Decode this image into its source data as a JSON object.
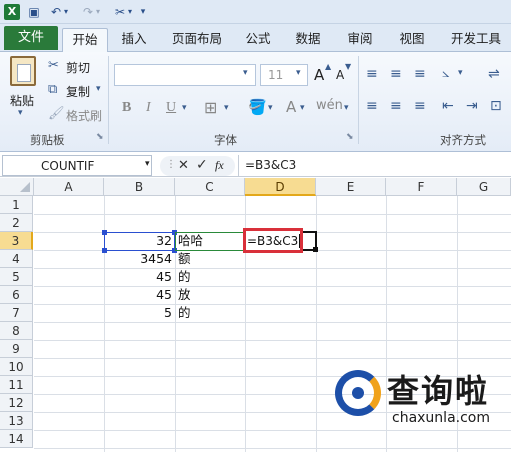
{
  "quick_access": {
    "icons": [
      "excel-icon",
      "save-icon",
      "undo-icon",
      "redo-icon",
      "custom-tool-icon",
      "customize-dropdown-icon"
    ]
  },
  "ribbon_tabs": {
    "file": "文件",
    "tabs": [
      "开始",
      "插入",
      "页面布局",
      "公式",
      "数据",
      "审阅",
      "视图",
      "开发工具"
    ],
    "active": "开始"
  },
  "ribbon": {
    "clipboard": {
      "paste": "粘贴",
      "cut": "剪切",
      "copy": "复制",
      "format_painter": "格式刷",
      "group_label": "剪贴板"
    },
    "font": {
      "font_size": "11",
      "bold": "B",
      "italic": "I",
      "underline": "U",
      "grow": "A",
      "shrink": "A",
      "font_color": "A",
      "group_label": "字体"
    },
    "alignment": {
      "group_label": "对齐方式"
    }
  },
  "formula_bar": {
    "name_box": "COUNTIF",
    "cancel": "✕",
    "enter": "✓",
    "fx": "fx",
    "formula": "=B3&C3"
  },
  "grid": {
    "columns": [
      "A",
      "B",
      "C",
      "D",
      "E",
      "F",
      "G"
    ],
    "rows": [
      "1",
      "2",
      "3",
      "4",
      "5",
      "6",
      "7",
      "8",
      "9",
      "10",
      "11",
      "12",
      "13",
      "14"
    ],
    "active_cell": "D3",
    "cells": {
      "B3": "32",
      "C3": "哈哈",
      "D3": "=B3&C3",
      "B4": "3454",
      "C4": "额",
      "B5": "45",
      "C5": "的",
      "B6": "45",
      "C6": "放",
      "B7": "5",
      "C7": "的"
    }
  },
  "watermark": {
    "brand": "查询啦",
    "domain": "chaxunla.com"
  },
  "colors": {
    "file_tab": "#2a7a3a",
    "selected_header": "#f7dc92",
    "highlight_box": "#d9303a"
  }
}
